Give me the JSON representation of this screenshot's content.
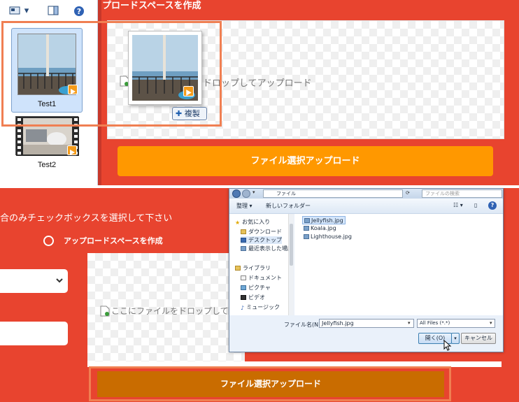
{
  "top_panel": {
    "heading": "プロードスペースを作成",
    "drop_zone_text": "をドロップしてアップロード",
    "copy_badge": "複製",
    "upload_button": "ファイル選択アップロード",
    "explorer": {
      "toolbar_icons": [
        "view-icon",
        "dropdown-icon",
        "preview-pane-icon",
        "help-icon"
      ],
      "items": [
        {
          "label": "Test1",
          "selected": true
        },
        {
          "label": "Test2",
          "selected": false
        }
      ]
    }
  },
  "bottom_panel": {
    "instruction": "合のみチェックボックスを選択して下さい",
    "radio_label": "アップロードスペースを作成",
    "drop_zone_text": "ここにファイルをドロップしてア",
    "upload_button": "ファイル選択アップロード"
  },
  "file_dialog": {
    "address": "ファイル",
    "search_placeholder": "ファイルの検索",
    "toolbar": {
      "organize": "整理 ▾",
      "new_folder": "新しいフォルダー"
    },
    "nav_items": [
      {
        "label": "お気に入り",
        "icon": "star-icon"
      },
      {
        "label": "ダウンロード",
        "icon": "download-folder-icon"
      },
      {
        "label": "デスクトップ",
        "icon": "desktop-icon"
      },
      {
        "label": "最近表示した場所",
        "icon": "recent-places-icon"
      },
      {
        "label": "ライブラリ",
        "icon": "library-icon"
      },
      {
        "label": "ドキュメント",
        "icon": "documents-icon"
      },
      {
        "label": "ピクチャ",
        "icon": "pictures-icon"
      },
      {
        "label": "ビデオ",
        "icon": "video-icon"
      },
      {
        "label": "ミュージック",
        "icon": "music-icon"
      }
    ],
    "files": [
      {
        "name": "Jellyfish.jpg",
        "selected": true
      },
      {
        "name": "Koala.jpg",
        "selected": false
      },
      {
        "name": "Lighthouse.jpg",
        "selected": false
      }
    ],
    "filename_label": "ファイル名(N):",
    "filename_value": "Jellyfish.jpg",
    "file_type": "All Files (*.*)",
    "open_button": "開く(O)",
    "cancel_button": "キャンセル"
  },
  "colors": {
    "orange_bg": "#e8442f",
    "upload_button_top": "#ff9800",
    "upload_button_bottom": "#c96c00",
    "highlight": "#f07f52"
  }
}
